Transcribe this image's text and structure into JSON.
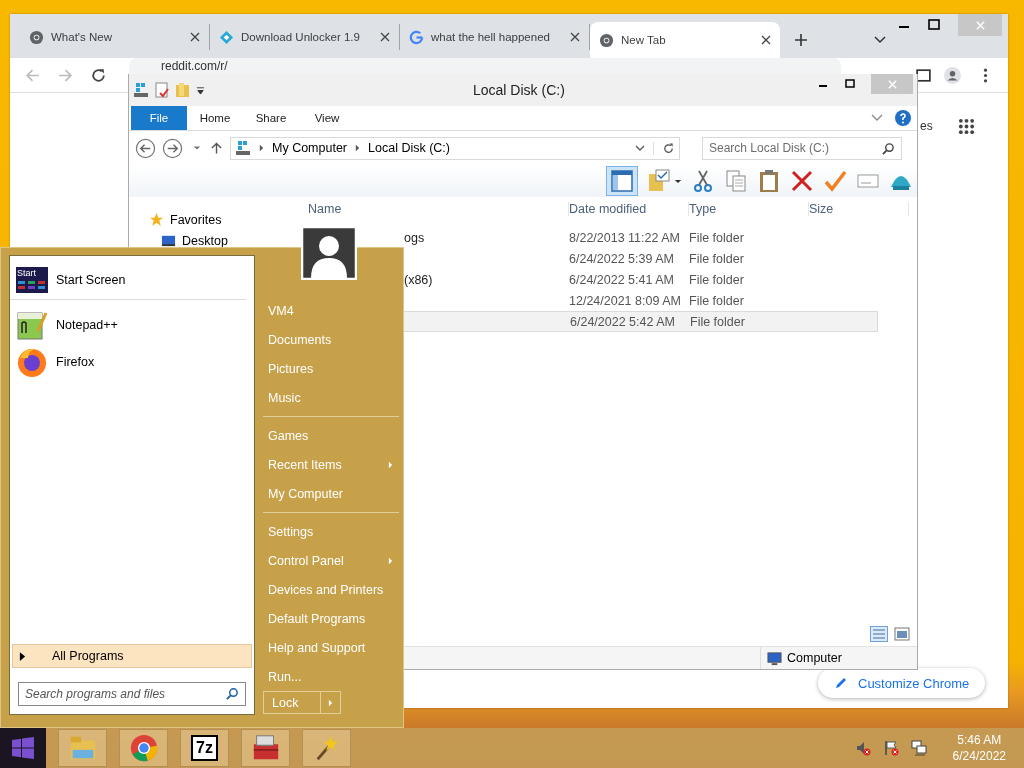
{
  "browser": {
    "tabs": [
      {
        "title": "What's New",
        "kind": "chrome",
        "selected": false
      },
      {
        "title": "Download Unlocker 1.9",
        "kind": "diamond",
        "selected": false
      },
      {
        "title": "what the hell happened",
        "kind": "google",
        "selected": false
      },
      {
        "title": "New Tab",
        "kind": "chrome",
        "selected": true
      }
    ],
    "address": "reddit.com/r/",
    "page_fragment": "es",
    "customize_button": "Customize Chrome"
  },
  "explorer": {
    "title": "Local Disk (C:)",
    "ribbon_tabs": [
      {
        "label": "File",
        "selected": true
      },
      {
        "label": "Home",
        "selected": false
      },
      {
        "label": "Share",
        "selected": false
      },
      {
        "label": "View",
        "selected": false
      }
    ],
    "breadcrumb": [
      "My Computer",
      "Local Disk (C:)"
    ],
    "search": {
      "placeholder": "Search Local Disk (C:)"
    },
    "navigation": [
      {
        "label": "Favorites",
        "kind": "group"
      },
      {
        "label": "Desktop",
        "kind": "item"
      }
    ],
    "columns": [
      "Name",
      "Date modified",
      "Type",
      "Size"
    ],
    "rows": [
      {
        "name": "ogs",
        "date": "8/22/2013 11:22 AM",
        "type": "File folder",
        "selected": false
      },
      {
        "date": "6/24/2022 5:39 AM",
        "type": "File folder",
        "selected": false
      },
      {
        "name": "(x86)",
        "date": "6/24/2022 5:41 AM",
        "type": "File folder",
        "selected": false
      },
      {
        "date": "12/24/2021 8:09 AM",
        "type": "File folder",
        "selected": false
      },
      {
        "date": "6/24/2022 5:42 AM",
        "type": "File folder",
        "selected": true
      }
    ],
    "status": "Computer"
  },
  "start_menu": {
    "programs": [
      {
        "label": "Start Screen",
        "kind": "tiles",
        "icon_text": "Start"
      },
      {
        "label": "Notepad++",
        "kind": "notepad"
      },
      {
        "label": "Firefox",
        "kind": "fox"
      }
    ],
    "all_programs": "All Programs",
    "search": {
      "placeholder": "Search programs and files"
    },
    "place_groups": [
      {
        "items": [
          {
            "label": "VM4",
            "submenu": false
          },
          {
            "label": "Documents",
            "submenu": false
          },
          {
            "label": "Pictures",
            "submenu": false
          },
          {
            "label": "Music",
            "submenu": false
          }
        ]
      },
      {
        "items": [
          {
            "label": "Games",
            "submenu": false
          },
          {
            "label": "Recent Items",
            "submenu": true
          },
          {
            "label": "My Computer",
            "submenu": false
          }
        ]
      },
      {
        "items": [
          {
            "label": "Settings",
            "submenu": false
          },
          {
            "label": "Control Panel",
            "submenu": true
          },
          {
            "label": "Devices and Printers",
            "submenu": false
          },
          {
            "label": "Default Programs",
            "submenu": false
          },
          {
            "label": "Help and Support",
            "submenu": false
          },
          {
            "label": "Run...",
            "submenu": false
          }
        ]
      }
    ],
    "lock": "Lock"
  },
  "taskbar": {
    "apps": [
      {
        "kind": "explorer"
      },
      {
        "kind": "chrome"
      },
      {
        "kind": "archiver",
        "label": "7z"
      },
      {
        "kind": "toolbox"
      },
      {
        "kind": "wand"
      }
    ],
    "time": "5:46 AM",
    "date": "6/24/2022"
  }
}
